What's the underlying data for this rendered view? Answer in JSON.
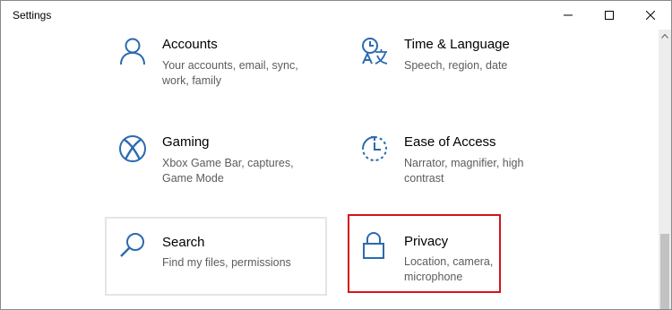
{
  "window": {
    "title": "Settings",
    "controls": {
      "minimize": "minimize",
      "maximize": "maximize",
      "close": "close"
    }
  },
  "tiles": [
    {
      "name": "Accounts",
      "description": "Your accounts, email, sync, work, family",
      "icon": "person-icon"
    },
    {
      "name": "Time & Language",
      "description": "Speech, region, date",
      "icon": "time-language-icon"
    },
    {
      "name": "Gaming",
      "description": "Xbox Game Bar, captures, Game Mode",
      "icon": "xbox-icon"
    },
    {
      "name": "Ease of Access",
      "description": "Narrator, magnifier, high contrast",
      "icon": "ease-of-access-icon"
    },
    {
      "name": "Search",
      "description": "Find my files, permissions",
      "icon": "search-icon",
      "state": "hovered"
    },
    {
      "name": "Privacy",
      "description": "Location, camera, microphone",
      "icon": "lock-icon",
      "state": "highlighted"
    }
  ],
  "colors": {
    "accent": "#2b6ab0",
    "highlight_border": "#d4141c",
    "hover_border": "#e5e5e5"
  }
}
